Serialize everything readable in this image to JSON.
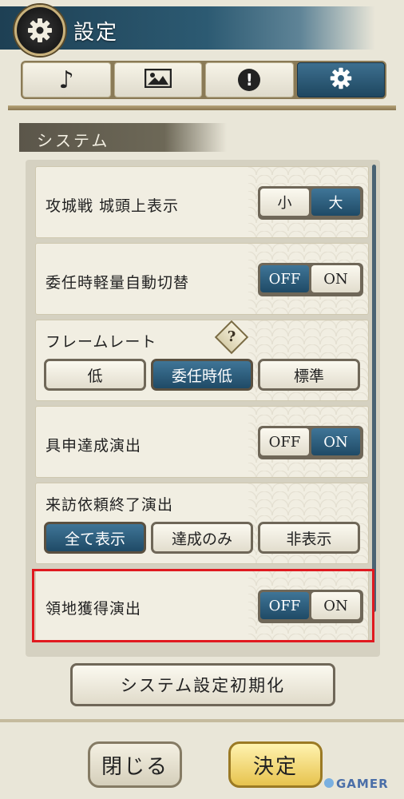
{
  "header": {
    "title": "設定"
  },
  "tabs": [
    {
      "icon": "music-note-icon",
      "glyph": "♪",
      "active": false
    },
    {
      "icon": "image-icon",
      "glyph": "",
      "active": false
    },
    {
      "icon": "exclamation-icon",
      "glyph": "!",
      "active": false
    },
    {
      "icon": "gear-icon",
      "glyph": "",
      "active": true
    }
  ],
  "section": {
    "title": "システム"
  },
  "settings": {
    "castle_label": {
      "label": "攻城戦 城頭上表示",
      "options": [
        "小",
        "大"
      ],
      "selected": "大"
    },
    "lightweight": {
      "label": "委任時軽量自動切替",
      "options": [
        "OFF",
        "ON"
      ],
      "selected": "OFF"
    },
    "framerate": {
      "label": "フレームレート",
      "help": "?",
      "options": [
        "低",
        "委任時低",
        "標準"
      ],
      "selected": "委任時低"
    },
    "gushin": {
      "label": "具申達成演出",
      "options": [
        "OFF",
        "ON"
      ],
      "selected": "ON"
    },
    "visit": {
      "label": "来訪依頼終了演出",
      "options": [
        "全て表示",
        "達成のみ",
        "非表示"
      ],
      "selected": "全て表示"
    },
    "territory": {
      "label": "領地獲得演出",
      "options": [
        "OFF",
        "ON"
      ],
      "selected": "OFF"
    }
  },
  "buttons": {
    "reset": "システム設定初期化",
    "close": "閉じる",
    "ok": "決定"
  },
  "watermark": "GAMER",
  "colors": {
    "accent_blue": "#2c5a72",
    "highlight_red": "#e0191f",
    "confirm_gold": "#e7c34e"
  }
}
